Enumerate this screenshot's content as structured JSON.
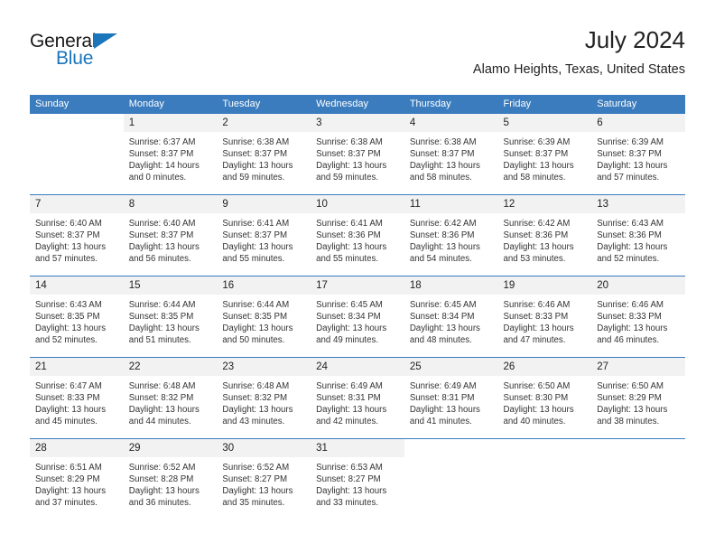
{
  "brand": {
    "name_part1": "General",
    "name_part2": "Blue",
    "triangle_icon": "triangle-icon",
    "accent_color": "#1b75bb"
  },
  "header": {
    "title": "July 2024",
    "subtitle": "Alamo Heights, Texas, United States"
  },
  "theme": {
    "header_bg": "#3a7cbe",
    "daynum_bg": "#f2f2f2",
    "separator": "#3a7cbe"
  },
  "columns": [
    "Sunday",
    "Monday",
    "Tuesday",
    "Wednesday",
    "Thursday",
    "Friday",
    "Saturday"
  ],
  "weeks": [
    [
      {
        "day": "",
        "sunrise": "",
        "sunset": "",
        "daylight_line1": "",
        "daylight_line2": ""
      },
      {
        "day": "1",
        "sunrise": "Sunrise: 6:37 AM",
        "sunset": "Sunset: 8:37 PM",
        "daylight_line1": "Daylight: 14 hours",
        "daylight_line2": "and 0 minutes."
      },
      {
        "day": "2",
        "sunrise": "Sunrise: 6:38 AM",
        "sunset": "Sunset: 8:37 PM",
        "daylight_line1": "Daylight: 13 hours",
        "daylight_line2": "and 59 minutes."
      },
      {
        "day": "3",
        "sunrise": "Sunrise: 6:38 AM",
        "sunset": "Sunset: 8:37 PM",
        "daylight_line1": "Daylight: 13 hours",
        "daylight_line2": "and 59 minutes."
      },
      {
        "day": "4",
        "sunrise": "Sunrise: 6:38 AM",
        "sunset": "Sunset: 8:37 PM",
        "daylight_line1": "Daylight: 13 hours",
        "daylight_line2": "and 58 minutes."
      },
      {
        "day": "5",
        "sunrise": "Sunrise: 6:39 AM",
        "sunset": "Sunset: 8:37 PM",
        "daylight_line1": "Daylight: 13 hours",
        "daylight_line2": "and 58 minutes."
      },
      {
        "day": "6",
        "sunrise": "Sunrise: 6:39 AM",
        "sunset": "Sunset: 8:37 PM",
        "daylight_line1": "Daylight: 13 hours",
        "daylight_line2": "and 57 minutes."
      }
    ],
    [
      {
        "day": "7",
        "sunrise": "Sunrise: 6:40 AM",
        "sunset": "Sunset: 8:37 PM",
        "daylight_line1": "Daylight: 13 hours",
        "daylight_line2": "and 57 minutes."
      },
      {
        "day": "8",
        "sunrise": "Sunrise: 6:40 AM",
        "sunset": "Sunset: 8:37 PM",
        "daylight_line1": "Daylight: 13 hours",
        "daylight_line2": "and 56 minutes."
      },
      {
        "day": "9",
        "sunrise": "Sunrise: 6:41 AM",
        "sunset": "Sunset: 8:37 PM",
        "daylight_line1": "Daylight: 13 hours",
        "daylight_line2": "and 55 minutes."
      },
      {
        "day": "10",
        "sunrise": "Sunrise: 6:41 AM",
        "sunset": "Sunset: 8:36 PM",
        "daylight_line1": "Daylight: 13 hours",
        "daylight_line2": "and 55 minutes."
      },
      {
        "day": "11",
        "sunrise": "Sunrise: 6:42 AM",
        "sunset": "Sunset: 8:36 PM",
        "daylight_line1": "Daylight: 13 hours",
        "daylight_line2": "and 54 minutes."
      },
      {
        "day": "12",
        "sunrise": "Sunrise: 6:42 AM",
        "sunset": "Sunset: 8:36 PM",
        "daylight_line1": "Daylight: 13 hours",
        "daylight_line2": "and 53 minutes."
      },
      {
        "day": "13",
        "sunrise": "Sunrise: 6:43 AM",
        "sunset": "Sunset: 8:36 PM",
        "daylight_line1": "Daylight: 13 hours",
        "daylight_line2": "and 52 minutes."
      }
    ],
    [
      {
        "day": "14",
        "sunrise": "Sunrise: 6:43 AM",
        "sunset": "Sunset: 8:35 PM",
        "daylight_line1": "Daylight: 13 hours",
        "daylight_line2": "and 52 minutes."
      },
      {
        "day": "15",
        "sunrise": "Sunrise: 6:44 AM",
        "sunset": "Sunset: 8:35 PM",
        "daylight_line1": "Daylight: 13 hours",
        "daylight_line2": "and 51 minutes."
      },
      {
        "day": "16",
        "sunrise": "Sunrise: 6:44 AM",
        "sunset": "Sunset: 8:35 PM",
        "daylight_line1": "Daylight: 13 hours",
        "daylight_line2": "and 50 minutes."
      },
      {
        "day": "17",
        "sunrise": "Sunrise: 6:45 AM",
        "sunset": "Sunset: 8:34 PM",
        "daylight_line1": "Daylight: 13 hours",
        "daylight_line2": "and 49 minutes."
      },
      {
        "day": "18",
        "sunrise": "Sunrise: 6:45 AM",
        "sunset": "Sunset: 8:34 PM",
        "daylight_line1": "Daylight: 13 hours",
        "daylight_line2": "and 48 minutes."
      },
      {
        "day": "19",
        "sunrise": "Sunrise: 6:46 AM",
        "sunset": "Sunset: 8:33 PM",
        "daylight_line1": "Daylight: 13 hours",
        "daylight_line2": "and 47 minutes."
      },
      {
        "day": "20",
        "sunrise": "Sunrise: 6:46 AM",
        "sunset": "Sunset: 8:33 PM",
        "daylight_line1": "Daylight: 13 hours",
        "daylight_line2": "and 46 minutes."
      }
    ],
    [
      {
        "day": "21",
        "sunrise": "Sunrise: 6:47 AM",
        "sunset": "Sunset: 8:33 PM",
        "daylight_line1": "Daylight: 13 hours",
        "daylight_line2": "and 45 minutes."
      },
      {
        "day": "22",
        "sunrise": "Sunrise: 6:48 AM",
        "sunset": "Sunset: 8:32 PM",
        "daylight_line1": "Daylight: 13 hours",
        "daylight_line2": "and 44 minutes."
      },
      {
        "day": "23",
        "sunrise": "Sunrise: 6:48 AM",
        "sunset": "Sunset: 8:32 PM",
        "daylight_line1": "Daylight: 13 hours",
        "daylight_line2": "and 43 minutes."
      },
      {
        "day": "24",
        "sunrise": "Sunrise: 6:49 AM",
        "sunset": "Sunset: 8:31 PM",
        "daylight_line1": "Daylight: 13 hours",
        "daylight_line2": "and 42 minutes."
      },
      {
        "day": "25",
        "sunrise": "Sunrise: 6:49 AM",
        "sunset": "Sunset: 8:31 PM",
        "daylight_line1": "Daylight: 13 hours",
        "daylight_line2": "and 41 minutes."
      },
      {
        "day": "26",
        "sunrise": "Sunrise: 6:50 AM",
        "sunset": "Sunset: 8:30 PM",
        "daylight_line1": "Daylight: 13 hours",
        "daylight_line2": "and 40 minutes."
      },
      {
        "day": "27",
        "sunrise": "Sunrise: 6:50 AM",
        "sunset": "Sunset: 8:29 PM",
        "daylight_line1": "Daylight: 13 hours",
        "daylight_line2": "and 38 minutes."
      }
    ],
    [
      {
        "day": "28",
        "sunrise": "Sunrise: 6:51 AM",
        "sunset": "Sunset: 8:29 PM",
        "daylight_line1": "Daylight: 13 hours",
        "daylight_line2": "and 37 minutes."
      },
      {
        "day": "29",
        "sunrise": "Sunrise: 6:52 AM",
        "sunset": "Sunset: 8:28 PM",
        "daylight_line1": "Daylight: 13 hours",
        "daylight_line2": "and 36 minutes."
      },
      {
        "day": "30",
        "sunrise": "Sunrise: 6:52 AM",
        "sunset": "Sunset: 8:27 PM",
        "daylight_line1": "Daylight: 13 hours",
        "daylight_line2": "and 35 minutes."
      },
      {
        "day": "31",
        "sunrise": "Sunrise: 6:53 AM",
        "sunset": "Sunset: 8:27 PM",
        "daylight_line1": "Daylight: 13 hours",
        "daylight_line2": "and 33 minutes."
      },
      {
        "day": "",
        "sunrise": "",
        "sunset": "",
        "daylight_line1": "",
        "daylight_line2": ""
      },
      {
        "day": "",
        "sunrise": "",
        "sunset": "",
        "daylight_line1": "",
        "daylight_line2": ""
      },
      {
        "day": "",
        "sunrise": "",
        "sunset": "",
        "daylight_line1": "",
        "daylight_line2": ""
      }
    ]
  ]
}
